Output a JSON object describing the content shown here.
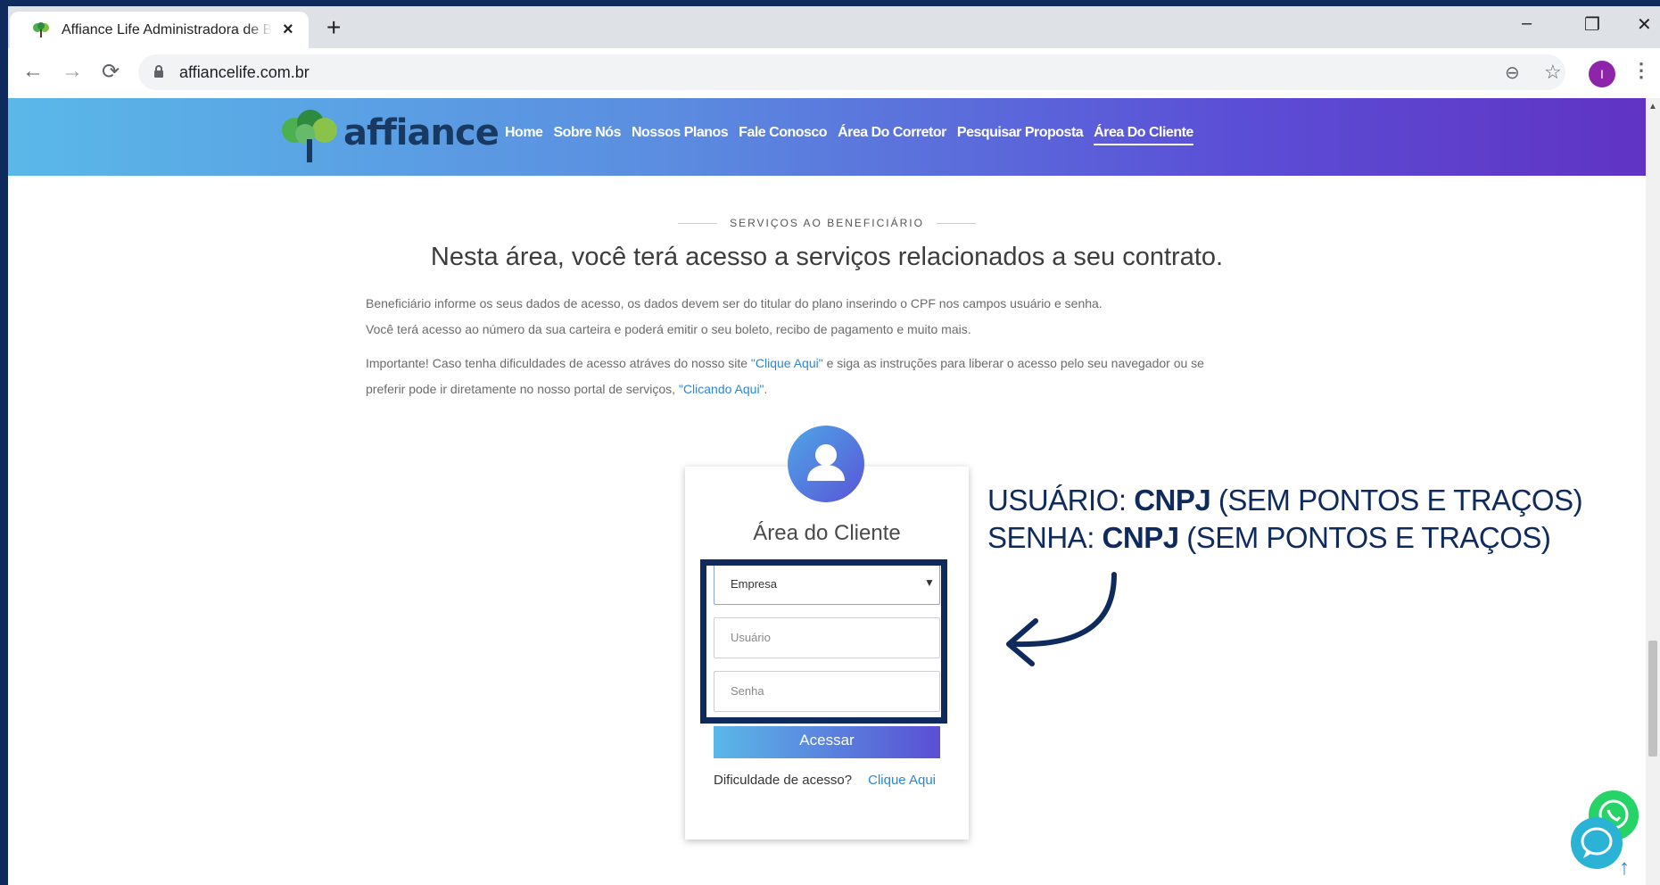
{
  "browser": {
    "tab_title": "Affiance Life Administradora de Be",
    "tab_close": "×",
    "new_tab": "+",
    "url": "affiancelife.com.br",
    "profile_initial": "I",
    "window_controls": {
      "minimize": "–",
      "restore": "❐",
      "close": "✕"
    },
    "nav": {
      "back": "←",
      "forward": "→",
      "reload": "⟳"
    },
    "zoom_icon": "⊖",
    "star_icon": "☆",
    "menu_icon": "⋮"
  },
  "site": {
    "logo_text": "affiance",
    "nav_items": [
      "Home",
      "Sobre Nós",
      "Nossos Planos",
      "Fale Conosco",
      "Área Do Corretor",
      "Pesquisar Proposta",
      "Área Do Cliente"
    ],
    "active_nav": "Área Do Cliente",
    "eyebrow": "SERVIÇOS AO BENEFICIÁRIO",
    "heading": "Nesta área, você terá acesso a serviços relacionados a seu contrato.",
    "paragraph_1": "Beneficiário informe os seus dados de acesso, os dados devem ser do titular do plano inserindo o CPF nos campos usuário e senha.",
    "paragraph_2": "Você terá acesso ao número da sua carteira e poderá emitir o seu boleto, recibo de pagamento e muito mais.",
    "paragraph_3_prefix": "Importante! Caso tenha dificuldades de acesso atráves do nosso site ",
    "paragraph_3_link": "\"Clique Aqui\"",
    "paragraph_3_mid": " e siga as instruções para liberar o acesso pelo seu navegador ou se",
    "paragraph_4_prefix": "preferir pode ir diretamente no nosso portal de serviços, ",
    "paragraph_4_link": "\"Clicando Aqui\"",
    "paragraph_4_suffix": "."
  },
  "login": {
    "title": "Área do Cliente",
    "select_value": "Empresa",
    "select_caret": "▼",
    "user_placeholder": "Usuário",
    "password_placeholder": "Senha",
    "submit_label": "Acessar",
    "help_text": "Dificuldade de acesso?",
    "help_link": "Clique Aqui"
  },
  "annotation": {
    "line1_a": "USUÁRIO: ",
    "line1_b": "CNPJ",
    "line1_c": " (SEM PONTOS E TRAÇOS)",
    "line2_a": "SENHA: ",
    "line2_b": "CNPJ",
    "line2_c": " (SEM PONTOS E TRAÇOS)",
    "accent_color": "#0f2a5c"
  },
  "floating": {
    "to_top": "↑"
  }
}
